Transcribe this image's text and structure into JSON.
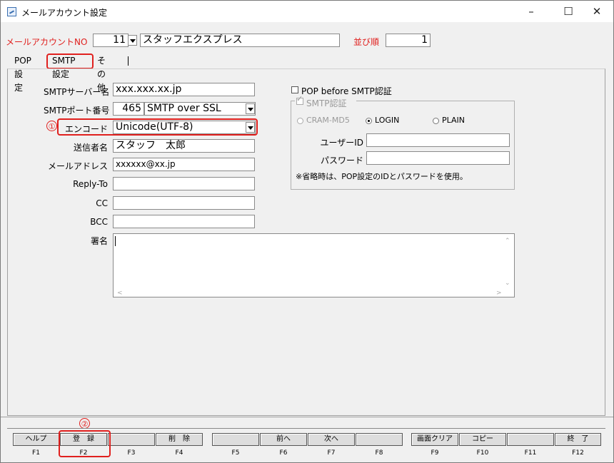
{
  "window": {
    "title": "メールアカウント設定",
    "minimize": "–",
    "maximize": "☐",
    "close": "✕"
  },
  "header": {
    "account_no_label": "メールアカウントNO",
    "account_no": "11",
    "account_name": "スタッフエクスプレス",
    "order_label": "並び順",
    "order_value": "1"
  },
  "tabs": [
    "POP設定",
    "SMTP設定",
    "その他"
  ],
  "smtp": {
    "server_label": "SMTPサーバー名",
    "server_value": "xxx.xxx.xx.jp",
    "port_label": "SMTPポート番号",
    "port_value": "465",
    "port_mode": "SMTP over SSL",
    "encode_label": "エンコード",
    "encode_value": "Unicode(UTF-8)",
    "sender_label": "送信者名",
    "sender_value": "スタッフ　太郎",
    "mail_label": "メールアドレス",
    "mail_value": "xxxxxx@xx.jp",
    "replyto_label": "Reply-To",
    "replyto_value": "",
    "cc_label": "CC",
    "cc_value": "",
    "bcc_label": "BCC",
    "bcc_value": "",
    "signature_label": "署名",
    "signature_value": ""
  },
  "auth": {
    "pop_before_label": "POP before SMTP認証",
    "smtp_auth_label": "SMTP認証",
    "cram": "CRAM-MD5",
    "login": "LOGIN",
    "plain": "PLAIN",
    "userid_label": "ユーザーID",
    "userid_value": "",
    "password_label": "パスワード",
    "password_value": "",
    "note": "※省略時は、POP設定のIDとパスワードを使用。"
  },
  "annotations": {
    "one": "①",
    "two": "②"
  },
  "fkeys": [
    {
      "label": "ヘルプ",
      "key": "F1"
    },
    {
      "label": "登　録",
      "key": "F2"
    },
    {
      "label": "",
      "key": "F3"
    },
    {
      "label": "削　除",
      "key": "F4"
    },
    {
      "label": "",
      "key": "F5"
    },
    {
      "label": "前へ",
      "key": "F6"
    },
    {
      "label": "次へ",
      "key": "F7"
    },
    {
      "label": "",
      "key": "F8"
    },
    {
      "label": "画面クリア",
      "key": "F9"
    },
    {
      "label": "コピー",
      "key": "F10"
    },
    {
      "label": "",
      "key": "F11"
    },
    {
      "label": "終　了",
      "key": "F12"
    }
  ]
}
